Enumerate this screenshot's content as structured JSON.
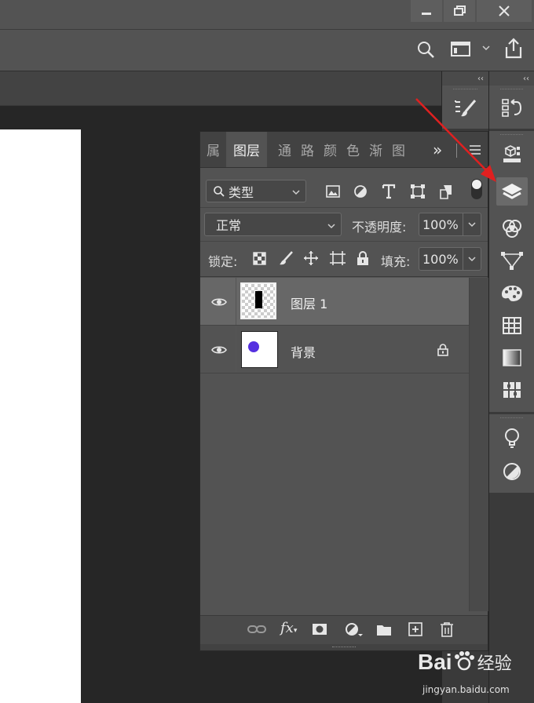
{
  "panel": {
    "tabs": [
      "属",
      "图层",
      "通",
      "路",
      "颜",
      "色",
      "渐",
      "图"
    ],
    "tab_overflow": "»",
    "filter_kind": "类型",
    "blend_mode": "正常",
    "opacity_label": "不透明度:",
    "opacity_value": "100%",
    "lock_label": "锁定:",
    "fill_label": "填充:",
    "fill_value": "100%",
    "layers": [
      {
        "name": "图层 1",
        "selected": true,
        "visible": true,
        "thumb": "black-rectangle",
        "locked": false
      },
      {
        "name": "背景",
        "selected": false,
        "visible": true,
        "thumb": "blue-dot",
        "locked": true
      }
    ]
  },
  "columns": {
    "collapse_glyph": "‹‹"
  },
  "watermark": {
    "brand": "Bai",
    "brand2": "经验",
    "site": "jingyan.baidu.com"
  },
  "colors": {
    "annotation_arrow": "#e02020",
    "background_dot": "#5530e0"
  }
}
